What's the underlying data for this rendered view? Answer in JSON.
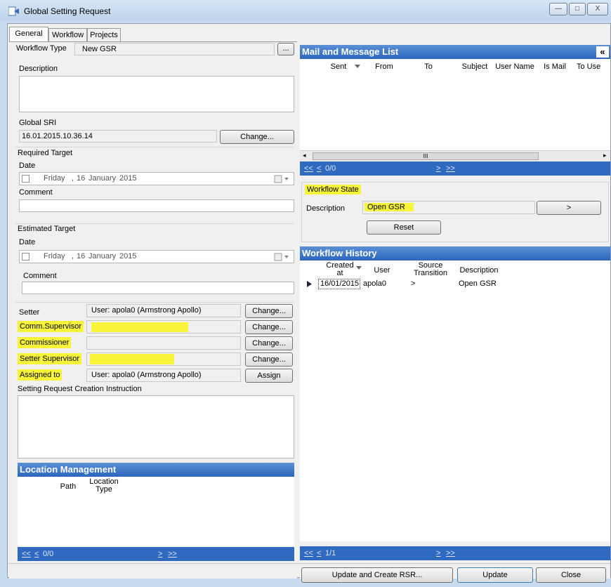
{
  "window": {
    "title": "Global Setting Request",
    "minimize": "—",
    "maximize": "□",
    "close": "X"
  },
  "tabs": [
    "General",
    "Workflow",
    "Projects"
  ],
  "general": {
    "workflow_type_label": "Workflow Type",
    "workflow_type_value": "New GSR",
    "browse_button": "...",
    "description_label": "Description",
    "global_sri_label": "Global SRI",
    "global_sri_value": "16.01.2015.10.36.14",
    "change_sri_button": "Change...",
    "required_target_label": "Required Target",
    "estimated_target_label": "Estimated Target",
    "date_label": "Date",
    "comment_label": "Comment",
    "required_date": {
      "weekday": "Friday",
      "comma": ",",
      "day": "16",
      "month": "January",
      "year": "2015"
    },
    "estimated_date": {
      "weekday": "Friday",
      "comma": ",",
      "day": "16",
      "month": "January",
      "year": "2015"
    },
    "roles": [
      {
        "label": "Setter",
        "value": "User: apola0 (Armstrong Apollo)",
        "button": "Change..."
      },
      {
        "label": "Comm.Supervisor",
        "value": "",
        "button": "Change..."
      },
      {
        "label": "Commissioner",
        "value": "",
        "button": "Change..."
      },
      {
        "label": "Setter Supervisor",
        "value": "",
        "button": "Change..."
      },
      {
        "label": "Assigned to",
        "value": "User: apola0 (Armstrong Apollo)",
        "button": "Assign"
      }
    ],
    "instruction_label": "Setting Request Creation Instruction"
  },
  "location_management": {
    "title": "Location Management",
    "columns": [
      "Path",
      "Location Type"
    ],
    "nav": {
      "first": "<<",
      "prev": "<",
      "count": "0/0",
      "next": ">",
      "last": ">>"
    }
  },
  "mail_list": {
    "title": "Mail and Message List",
    "collapse_icon": "«",
    "columns": [
      "Sent",
      "From",
      "To",
      "Subject",
      "User Name",
      "Is Mail",
      "To Use"
    ],
    "scroll_thumb": "III",
    "nav": {
      "first": "<<",
      "prev": "<",
      "count": "0/0",
      "next": ">",
      "last": ">>"
    }
  },
  "workflow_state": {
    "title": "Workflow State",
    "description_label": "Description",
    "description_value": "Open GSR",
    "go_button": ">",
    "reset_button": "Reset"
  },
  "workflow_history": {
    "title": "Workflow History",
    "columns": [
      "Created at",
      "User",
      "Source Transition",
      "Description"
    ],
    "rows": [
      {
        "created": "16/01/2015",
        "user": "apola0",
        "transition": ">",
        "description": "Open GSR"
      }
    ],
    "nav": {
      "first": "<<",
      "prev": "<",
      "count": "1/1",
      "next": ">",
      "last": ">>"
    }
  },
  "footer": {
    "update_create": "Update and Create RSR...",
    "update": "Update",
    "close": "Close"
  }
}
